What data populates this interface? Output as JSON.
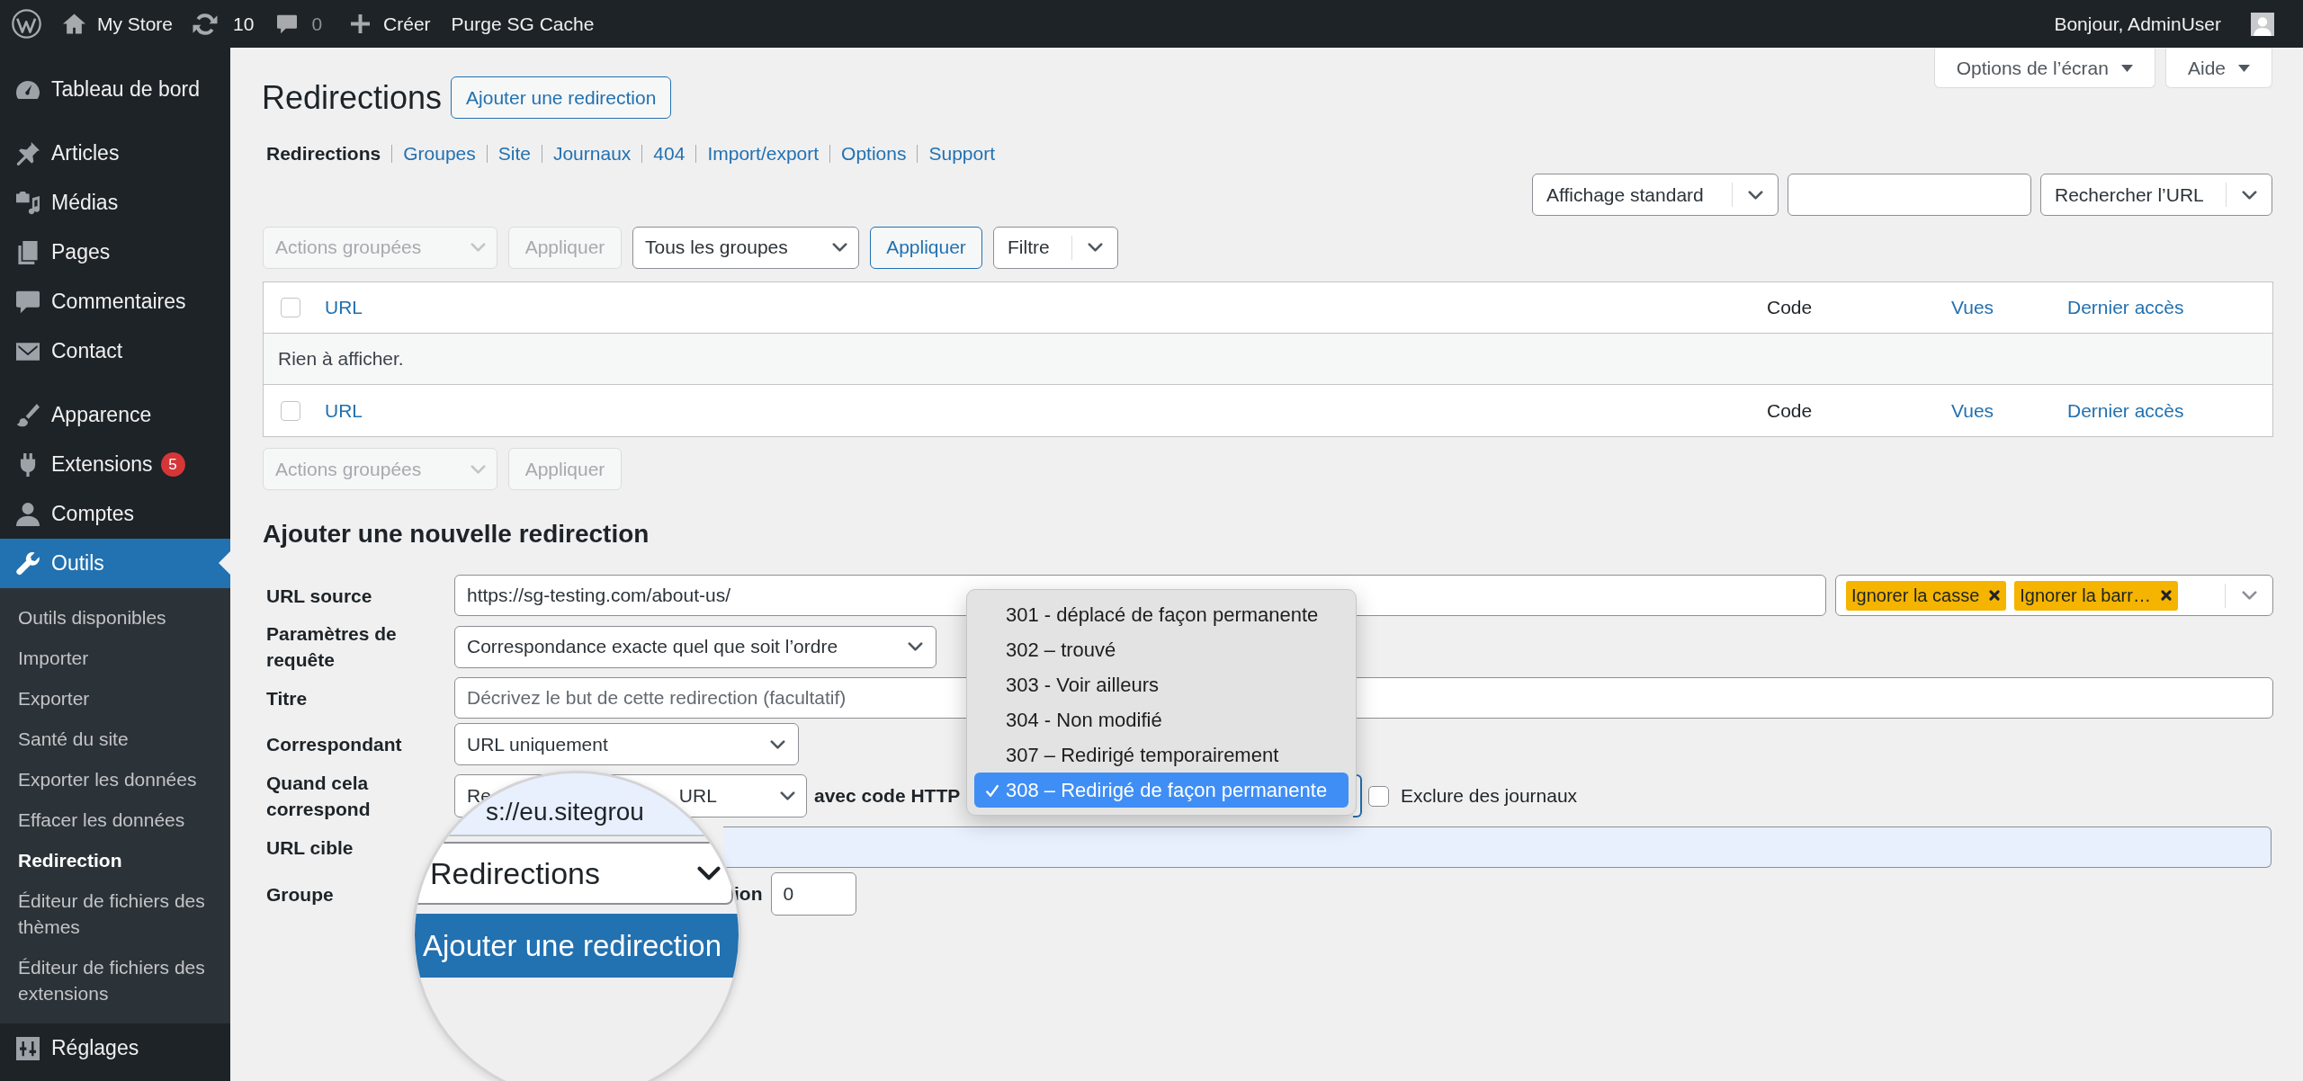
{
  "admin_bar": {
    "site": "My Store",
    "updates": "10",
    "comments": "0",
    "new": "Créer",
    "purge": "Purge SG Cache",
    "greeting": "Bonjour, AdminUser"
  },
  "sidebar": {
    "groups": [
      {
        "items": [
          {
            "label": "Tableau de bord",
            "selected": false
          }
        ]
      },
      {
        "items": [
          {
            "label": "Articles",
            "selected": false
          },
          {
            "label": "Médias",
            "selected": false
          },
          {
            "label": "Pages",
            "selected": false
          },
          {
            "label": "Commentaires",
            "selected": false
          },
          {
            "label": "Contact",
            "selected": false
          }
        ]
      },
      {
        "items": [
          {
            "label": "Apparence",
            "selected": false
          },
          {
            "label": "Extensions",
            "selected": false,
            "badge": "5"
          },
          {
            "label": "Comptes",
            "selected": false
          },
          {
            "label": "Outils",
            "selected": true,
            "submenu": [
              {
                "label": "Outils disponibles",
                "selected": false
              },
              {
                "label": "Importer",
                "selected": false
              },
              {
                "label": "Exporter",
                "selected": false
              },
              {
                "label": "Santé du site",
                "selected": false
              },
              {
                "label": "Exporter les données",
                "selected": false
              },
              {
                "label": "Effacer les données",
                "selected": false
              },
              {
                "label": "Redirection",
                "selected": true
              },
              {
                "label": "Éditeur de fichiers des thèmes",
                "selected": false
              },
              {
                "label": "Éditeur de fichiers des extensions",
                "selected": false
              }
            ]
          },
          {
            "label": "Réglages",
            "selected": false
          }
        ]
      }
    ]
  },
  "screen_meta": [
    {
      "label": "Options de l’écran"
    },
    {
      "label": "Aide"
    }
  ],
  "header": {
    "title": "Redirections",
    "add_button": "Ajouter une redirection"
  },
  "subnav": [
    {
      "label": "Redirections",
      "selected": true
    },
    {
      "label": "Groupes",
      "selected": false
    },
    {
      "label": "Site",
      "selected": false
    },
    {
      "label": "Journaux",
      "selected": false
    },
    {
      "label": "404",
      "selected": false
    },
    {
      "label": "Import/export",
      "selected": false
    },
    {
      "label": "Options",
      "selected": false
    },
    {
      "label": "Support",
      "selected": false
    }
  ],
  "search_bar": [
    {
      "kind": "split",
      "label": "Affichage standard"
    },
    {
      "kind": "input"
    },
    {
      "kind": "split",
      "label": "Rechercher l’URL"
    }
  ],
  "tablenav_top": [
    {
      "kind": "select",
      "label": "Actions groupées",
      "disabled": true
    },
    {
      "kind": "button",
      "label": "Appliquer",
      "disabled": true
    },
    {
      "kind": "select",
      "label": "Tous les groupes",
      "disabled": false
    },
    {
      "kind": "button",
      "label": "Appliquer",
      "disabled": false
    },
    {
      "kind": "split",
      "label": "Filtre"
    }
  ],
  "table": {
    "header": {
      "checked": false,
      "columns": [
        {
          "label": "URL",
          "sortable": true
        },
        {
          "label": "Code",
          "sortable": false
        },
        {
          "label": "Vues",
          "sortable": true
        },
        {
          "label": "Dernier accès",
          "sortable": true
        }
      ]
    },
    "empty_message": "Rien à afficher.",
    "footer": {
      "checked": false,
      "columns": [
        {
          "label": "URL",
          "sortable": true
        },
        {
          "label": "Code",
          "sortable": false
        },
        {
          "label": "Vues",
          "sortable": true
        },
        {
          "label": "Dernier accès",
          "sortable": true
        }
      ]
    }
  },
  "tablenav_bottom": [
    {
      "kind": "select",
      "label": "Actions groupées",
      "disabled": true
    },
    {
      "kind": "button",
      "label": "Appliquer",
      "disabled": true
    }
  ],
  "form": {
    "title": "Ajouter une nouvelle redirection",
    "rows": [
      {
        "kind": "url_source",
        "label": "URL source",
        "value": "https://sg-testing.com/about-us/",
        "flags": [
          {
            "label": "Ignorer la casse"
          },
          {
            "label": "Ignorer la barr…"
          }
        ]
      },
      {
        "kind": "select",
        "label": "Paramètres de requête",
        "value": "Correspondance exacte quel que soit l’ordre"
      },
      {
        "kind": "text",
        "label": "Titre",
        "placeholder": "Décrivez le but de cette redirection (facultatif)",
        "autofilled": false
      },
      {
        "kind": "select",
        "label": "Correspondant",
        "value": "URL uniquement"
      },
      {
        "kind": "action",
        "label": "Quand cela correspond",
        "value_start": "Re",
        "value_end": "URL",
        "code_label": "avec code HTTP",
        "exclude": {
          "label": "Exclure des journaux",
          "checked": false
        }
      },
      {
        "kind": "text",
        "label": "URL cible",
        "autofilled": true
      },
      {
        "kind": "group",
        "label": "Groupe",
        "position_label": "ion",
        "position_value": "0"
      }
    ]
  },
  "code_menu": {
    "options": [
      {
        "label": "301 - déplacé de façon permanente",
        "selected": false
      },
      {
        "label": "302 – trouvé",
        "selected": false
      },
      {
        "label": "303 - Voir ailleurs",
        "selected": false
      },
      {
        "label": "304 - Non modifié",
        "selected": false
      },
      {
        "label": "307 – Redirigé temporairement",
        "selected": false
      },
      {
        "label": "308 – Redirigé de façon permanente",
        "selected": true
      }
    ]
  },
  "magnifier": {
    "url_text": "s://eu.sitegrou",
    "group_value": "Redirections",
    "button": "Ajouter une redirection"
  }
}
